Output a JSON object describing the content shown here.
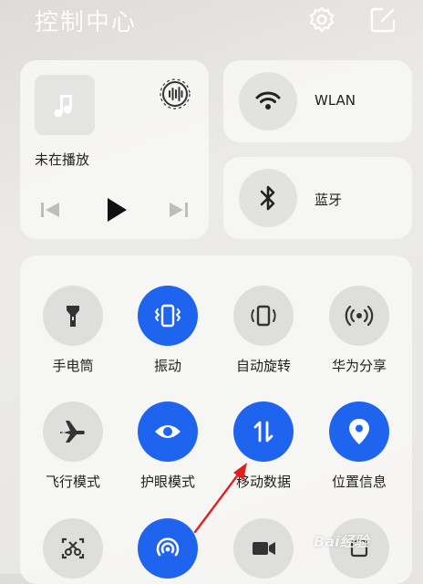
{
  "header": {
    "title": "控制中心"
  },
  "media": {
    "status": "未在播放"
  },
  "wlan": {
    "label": "WLAN"
  },
  "bluetooth": {
    "label": "蓝牙"
  },
  "tiles": [
    {
      "label": "手电筒",
      "state": "off"
    },
    {
      "label": "振动",
      "state": "on"
    },
    {
      "label": "自动旋转",
      "state": "off"
    },
    {
      "label": "华为分享",
      "state": "off"
    },
    {
      "label": "飞行模式",
      "state": "off"
    },
    {
      "label": "护眼模式",
      "state": "on"
    },
    {
      "label": "移动数据",
      "state": "on"
    },
    {
      "label": "位置信息",
      "state": "on"
    }
  ],
  "colors": {
    "accent": "#1f64ee",
    "annotation_arrow": "#e02020"
  },
  "watermark": {
    "text": "Bai经验"
  }
}
